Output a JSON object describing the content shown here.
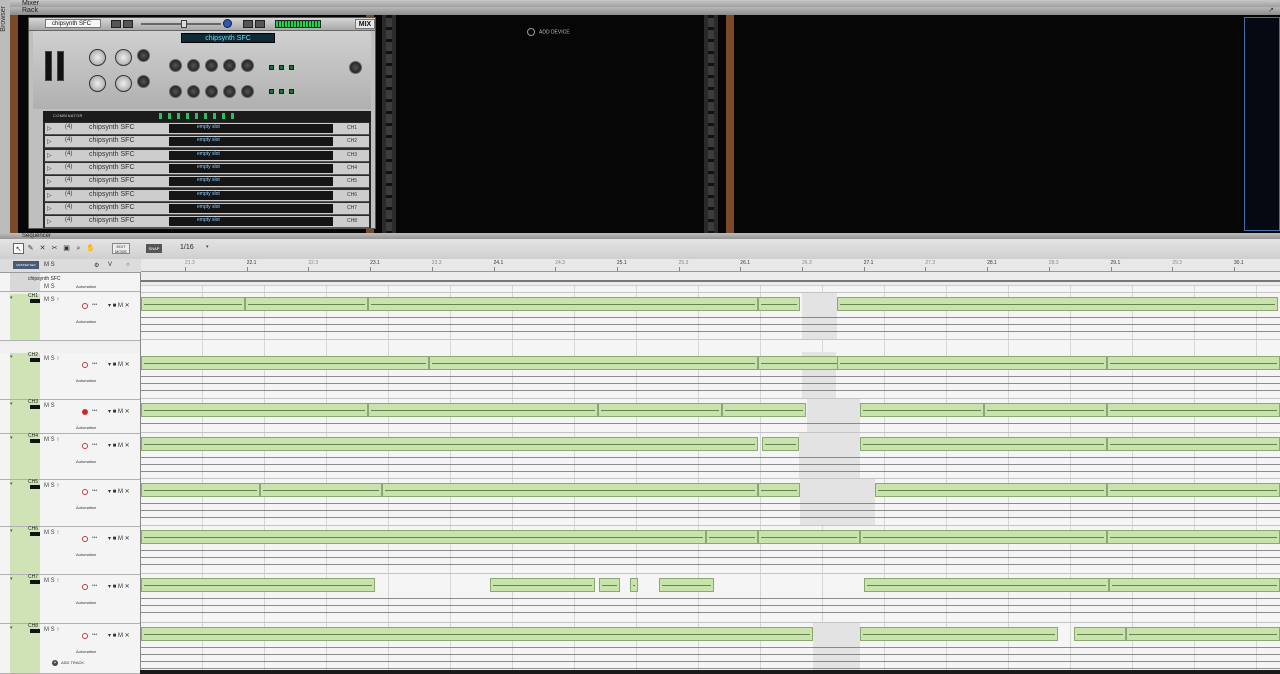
{
  "browser_tab": "Browser",
  "mixer": {
    "label": "Mixer"
  },
  "rack": {
    "label": "Rack",
    "combinator": {
      "device_name": "chipsynth SFC",
      "mix_badge": "MIX",
      "patch_name": "chipsynth SFC",
      "list_title": "COMBINATOR",
      "row_label": "chipsynth SFC",
      "bank_text": "empty slot",
      "rows": [
        {
          "num": "(4)",
          "ch": "CH1"
        },
        {
          "num": "(4)",
          "ch": "CH2"
        },
        {
          "num": "(4)",
          "ch": "CH3"
        },
        {
          "num": "(4)",
          "ch": "CH4"
        },
        {
          "num": "(4)",
          "ch": "CH5"
        },
        {
          "num": "(4)",
          "ch": "CH6"
        },
        {
          "num": "(4)",
          "ch": "CH7"
        },
        {
          "num": "(4)",
          "ch": "CH8"
        }
      ]
    },
    "add_device_label": "ADD DEVICE"
  },
  "sequencer": {
    "label": "Sequencer",
    "snap_label": "SNAP",
    "snap_value": "1/16",
    "edit_mode_label": "EDIT MODE",
    "master_label": "MASTER SEC",
    "header_ms": "M  S",
    "header_v": "V",
    "ruler": [
      {
        "label": "21.3",
        "sub": true
      },
      {
        "label": "22.1"
      },
      {
        "label": "22.3",
        "sub": true
      },
      {
        "label": "23.1"
      },
      {
        "label": "23.3",
        "sub": true
      },
      {
        "label": "24.1"
      },
      {
        "label": "24.3",
        "sub": true
      },
      {
        "label": "25.1"
      },
      {
        "label": "25.3",
        "sub": true
      },
      {
        "label": "26.1"
      },
      {
        "label": "26.3",
        "sub": true
      },
      {
        "label": "27.1"
      },
      {
        "label": "27.3",
        "sub": true
      },
      {
        "label": "28.1"
      },
      {
        "label": "28.3",
        "sub": true
      },
      {
        "label": "29.1"
      },
      {
        "label": "29.3",
        "sub": true
      },
      {
        "label": "30.1"
      }
    ],
    "combi_track": {
      "name": "chipsynth SFC",
      "automation": "Automation",
      "ms": "M  S"
    },
    "tracks": [
      {
        "name": "CH1",
        "ms": "M  S  ↑",
        "automation": "Automation",
        "record": false
      },
      {
        "name": "CH2",
        "ms": "M  S  ↑",
        "automation": "Automation",
        "record": false
      },
      {
        "name": "CH3",
        "ms": "M  S",
        "automation": "Automation",
        "record": true
      },
      {
        "name": "CH4",
        "ms": "M  S  ↑",
        "automation": "Automation",
        "record": false
      },
      {
        "name": "CH5",
        "ms": "M  S  ↑",
        "automation": "Automation",
        "record": false
      },
      {
        "name": "CH6",
        "ms": "M  S  ↑",
        "automation": "Automation",
        "record": false
      },
      {
        "name": "CH7",
        "ms": "M  S  ↑",
        "automation": "Automation",
        "record": false
      },
      {
        "name": "CH8",
        "ms": "M  S  ↑",
        "automation": "Automation",
        "record": false
      }
    ],
    "add_track_label": "ADD TRACK"
  },
  "colors": {
    "clip_fill": "#c9e3ad",
    "track_side": "#cfe3b6",
    "rack_rail": "#7a4a28",
    "lcd_text": "#6cd8ff"
  }
}
